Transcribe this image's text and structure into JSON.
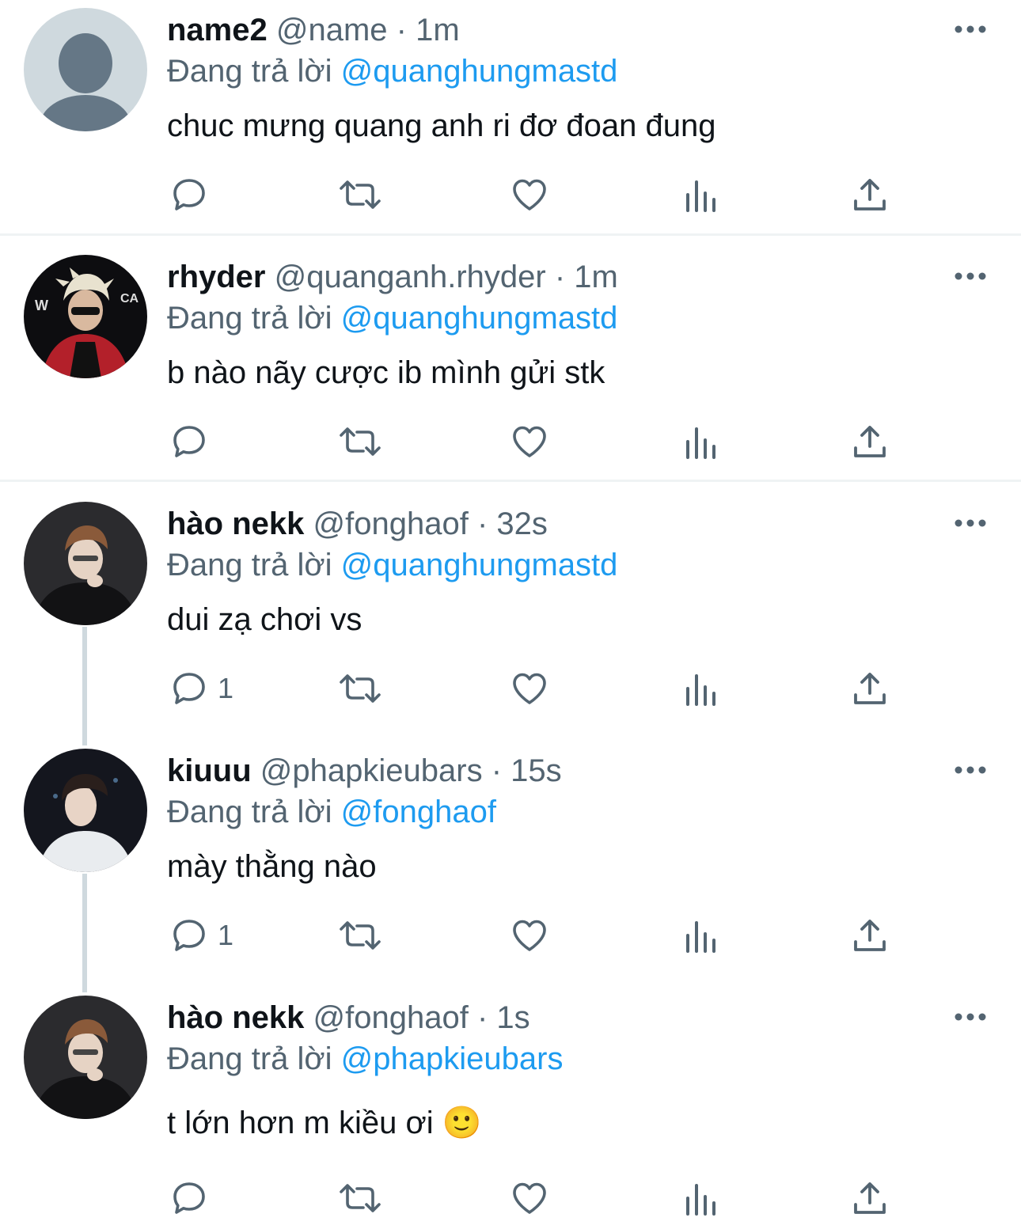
{
  "reply_prefix": "Đang trả lời",
  "tweets": [
    {
      "name": "name2",
      "handle": "@name",
      "time": "· 1m",
      "reply_to": "@quanghungmastd",
      "text": "chuc mưng quang anh ri đơ đoan đung",
      "reply_count": "",
      "avatar": "default-avatar"
    },
    {
      "name": "rhyder",
      "handle": "@quanganh.rhyder",
      "time": "· 1m",
      "reply_to": "@quanghungmastd",
      "text": "b nào nãy cược ib mình gửi stk",
      "reply_count": "",
      "avatar": "photo-avatar"
    },
    {
      "name": "hào nekk",
      "handle": "@fonghaof",
      "time": "· 32s",
      "reply_to": "@quanghungmastd",
      "text": "dui zạ chơi vs",
      "reply_count": "1",
      "avatar": "photo-avatar"
    },
    {
      "name": "kiuuu",
      "handle": "@phapkieubars",
      "time": "· 15s",
      "reply_to": "@fonghaof",
      "text": "mày thằng nào",
      "reply_count": "1",
      "avatar": "photo-avatar"
    },
    {
      "name": "hào nekk",
      "handle": "@fonghaof",
      "time": "· 1s",
      "reply_to": "@phapkieubars",
      "text": "t lớn hơn m kiều ơi 🙂",
      "reply_count": "",
      "avatar": "photo-avatar"
    }
  ],
  "colors": {
    "link": "#1d9bf0",
    "secondary": "#536471",
    "thread": "#cfd9de"
  }
}
